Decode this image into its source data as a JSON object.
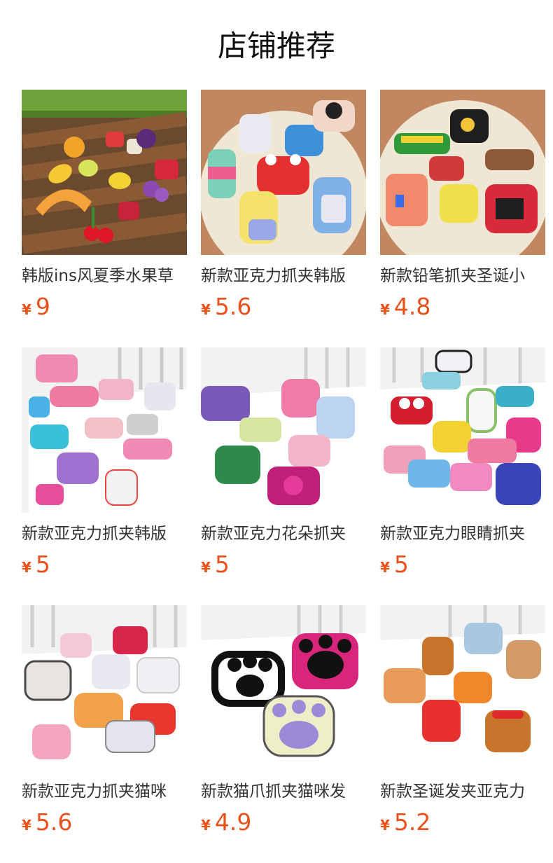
{
  "header": {
    "title": "店铺推荐"
  },
  "currency_symbol": "¥",
  "accent_color": "#e8511c",
  "products": [
    {
      "title": "韩版ins风夏季水果草",
      "price": "9",
      "image": "fruit-hair-claws-on-wooden-bench"
    },
    {
      "title": "新款亚克力抓夹韩版",
      "price": "5.6",
      "image": "cartoon-acrylic-claws-on-plate"
    },
    {
      "title": "新款铅笔抓夹圣诞小",
      "price": "4.8",
      "image": "pencil-christmas-claws-on-plate"
    },
    {
      "title": "新款亚克力抓夹韩版",
      "price": "5",
      "image": "rainbow-unicorn-claws-on-book"
    },
    {
      "title": "新款亚克力花朵抓夹",
      "price": "5",
      "image": "flower-claws-on-book"
    },
    {
      "title": "新款亚克力眼睛抓夹",
      "price": "5",
      "image": "eyes-claws-on-book"
    },
    {
      "title": "新款亚克力抓夹猫咪",
      "price": "5.6",
      "image": "cat-claws-on-book"
    },
    {
      "title": "新款猫爪抓夹猫咪发",
      "price": "4.9",
      "image": "cat-paw-claws-on-book"
    },
    {
      "title": "新款圣诞发夹亚克力",
      "price": "5.2",
      "image": "christmas-dog-claws-on-book"
    }
  ]
}
